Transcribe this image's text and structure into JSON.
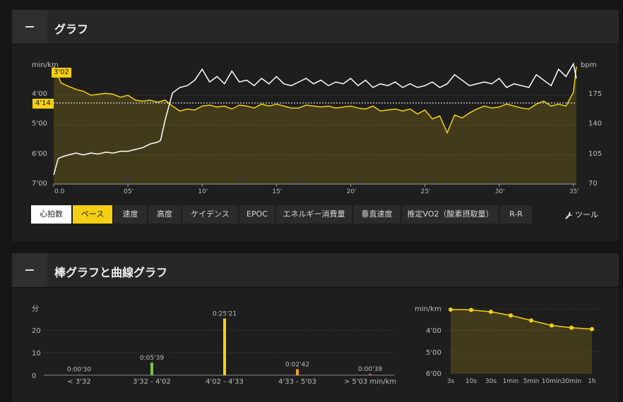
{
  "panels": {
    "graph": {
      "title": "グラフ"
    },
    "bars": {
      "title": "棒グラフと曲線グラフ"
    }
  },
  "graph": {
    "left_unit": "min/km",
    "right_unit": "bpm",
    "left_ticks": [
      "4'00",
      "5'00",
      "6'00",
      "7'00"
    ],
    "right_ticks": [
      "175",
      "140",
      "105",
      "70"
    ],
    "x_ticks": [
      "0.0",
      "05'",
      "10'",
      "15'",
      "20'",
      "25'",
      "30'",
      "35'"
    ],
    "max_pace_badge": "3'02",
    "avg_pace_badge": "4'14",
    "tabs": [
      "心拍数",
      "ペース",
      "速度",
      "高度",
      "ケイデンス",
      "EPOC",
      "エネルギー消費量",
      "垂直速度",
      "推定VO2（酸素摂取量）",
      "R-R"
    ],
    "tools_label": "ツール"
  },
  "histogram": {
    "y_unit": "分",
    "y_ticks": [
      "20",
      "10",
      "0"
    ],
    "bars": [
      {
        "label": "< 3'32",
        "value_label": "0:00'30",
        "minutes": 0.5,
        "color": "#5a5a5a"
      },
      {
        "label": "3'32 - 4'02",
        "value_label": "0:05'39",
        "minutes": 5.65,
        "color": "#7bc34f"
      },
      {
        "label": "4'02 - 4'33",
        "value_label": "0:25'21",
        "minutes": 25.35,
        "color": "#f5cf13"
      },
      {
        "label": "4'33 - 5'03",
        "value_label": "0:02'42",
        "minutes": 2.7,
        "color": "#f0a028"
      },
      {
        "label": "> 5'03 min/km",
        "value_label": "0:00'39",
        "minutes": 0.65,
        "color": "#d9534f"
      }
    ]
  },
  "curve": {
    "y_unit": "min/km",
    "y_ticks": [
      "4'00",
      "5'00",
      "6'00"
    ],
    "x_ticks": [
      "3s",
      "10s",
      "30s",
      "1min",
      "5min",
      "10min",
      "30min",
      "1h"
    ]
  },
  "chart_data": [
    {
      "type": "line",
      "title": "",
      "xlabel": "",
      "ylabel": "min/km",
      "y2label": "bpm",
      "x_unit_minutes": [
        0,
        5,
        10,
        15,
        20,
        25,
        30,
        35
      ],
      "pace_ylim_sec_per_km": [
        180,
        420
      ],
      "hr_ylim_bpm": [
        70,
        200
      ],
      "average_pace": "4'14",
      "max_pace": "3'02",
      "series": [
        {
          "key": "pace_sec_per_km",
          "color": "#f5cf13",
          "x": [
            0,
            0.5,
            1,
            1.5,
            2,
            2.5,
            3,
            3.5,
            4,
            4.5,
            5,
            5.5,
            6,
            6.5,
            7,
            7.5,
            8,
            8.5,
            9,
            9.5,
            10,
            10.5,
            11,
            11.5,
            12,
            12.5,
            13,
            13.5,
            14,
            14.5,
            15,
            15.5,
            16,
            16.5,
            17,
            17.5,
            18,
            18.5,
            19,
            19.5,
            20,
            20.5,
            21,
            21.5,
            22,
            22.5,
            23,
            23.5,
            24,
            24.5,
            25,
            25.5,
            26,
            26.5,
            27,
            27.5,
            28,
            28.5,
            29,
            29.5,
            30,
            30.5,
            31,
            31.5,
            32,
            32.5,
            33,
            33.5,
            34,
            34.5,
            35,
            35.2
          ],
          "values": [
            182,
            215,
            222,
            228,
            232,
            240,
            238,
            236,
            238,
            244,
            240,
            250,
            252,
            250,
            254,
            250,
            262,
            272,
            268,
            270,
            262,
            260,
            264,
            262,
            268,
            260,
            262,
            266,
            258,
            262,
            258,
            262,
            266,
            266,
            260,
            262,
            264,
            262,
            266,
            264,
            262,
            266,
            268,
            262,
            272,
            270,
            268,
            272,
            268,
            278,
            270,
            288,
            282,
            316,
            280,
            286,
            276,
            268,
            262,
            266,
            264,
            258,
            262,
            266,
            268,
            258,
            252,
            262,
            258,
            262,
            234,
            182
          ]
        },
        {
          "key": "heart_rate_bpm",
          "color": "#ffffff",
          "x": [
            0,
            0.3,
            0.6,
            1,
            1.5,
            2,
            2.5,
            3,
            3.5,
            4,
            4.5,
            5,
            5.5,
            6,
            6.5,
            7,
            7.2,
            7.5,
            8,
            8.5,
            9,
            9.5,
            10,
            10.5,
            11,
            11.5,
            12,
            12.5,
            13,
            13.5,
            14,
            14.5,
            15,
            15.5,
            16,
            16.5,
            17,
            17.5,
            18,
            18.5,
            19,
            19.5,
            20,
            20.5,
            21,
            21.5,
            22,
            22.5,
            23,
            23.5,
            24,
            24.5,
            25,
            25.5,
            26,
            26.5,
            27,
            27.5,
            28,
            28.5,
            29,
            29.5,
            30,
            30.5,
            31,
            31.5,
            32,
            32.5,
            33,
            33.5,
            34,
            34.5,
            35,
            35.2
          ],
          "values": [
            80,
            98,
            100,
            102,
            104,
            102,
            104,
            103,
            105,
            104,
            106,
            106,
            108,
            110,
            114,
            116,
            118,
            140,
            170,
            176,
            178,
            184,
            196,
            182,
            188,
            180,
            194,
            182,
            184,
            178,
            186,
            180,
            188,
            180,
            178,
            182,
            186,
            180,
            184,
            178,
            182,
            180,
            186,
            178,
            184,
            176,
            180,
            178,
            182,
            176,
            180,
            176,
            178,
            182,
            176,
            180,
            190,
            184,
            178,
            180,
            182,
            180,
            186,
            176,
            180,
            178,
            176,
            190,
            184,
            178,
            196,
            188,
            202,
            186
          ]
        }
      ]
    },
    {
      "type": "bar",
      "title": "",
      "xlabel": "min/km",
      "ylabel": "分",
      "categories": [
        "< 3'32",
        "3'32 - 4'02",
        "4'02 - 4'33",
        "4'33 - 5'03",
        "> 5'03"
      ],
      "values": [
        0.5,
        5.65,
        25.35,
        2.7,
        0.65
      ],
      "ylim": [
        0,
        27
      ]
    },
    {
      "type": "area",
      "title": "",
      "ylabel": "min/km",
      "categories": [
        "3s",
        "10s",
        "30s",
        "1min",
        "5min",
        "10min",
        "30min",
        "1h"
      ],
      "x": [
        "3s",
        "5s",
        "10s",
        "30s",
        "1min",
        "2min",
        "5min",
        "10min",
        "30min",
        "1h"
      ],
      "values_sec_per_km": [
        182,
        182,
        183,
        188,
        198,
        212,
        226,
        232,
        236,
        236
      ],
      "ylim_sec_per_km": [
        180,
        360
      ]
    }
  ]
}
